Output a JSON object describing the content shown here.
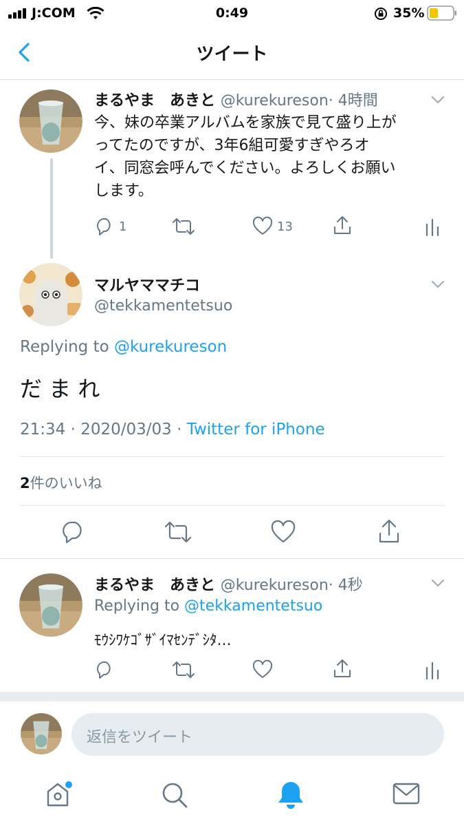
{
  "status_bar": {
    "carrier": "J:COM",
    "time": "0:49",
    "battery": "35%"
  },
  "nav": {
    "title": "ツイート"
  },
  "tweet1": {
    "name": "まるやま　あきと",
    "handle": "@kurekureson",
    "time": "· 4時間",
    "text_lines": [
      "今、妹の卒業アルバムを家族で見て盛り上が",
      "ってたのですが、3年6組可愛すぎやろオ",
      "イ、同窓会呼んでください。よろしくお願い",
      "します。"
    ],
    "reply_count": "1",
    "like_count": "13"
  },
  "main_tweet": {
    "name": "マルヤママチコ",
    "handle": "@tekkamentetsuo",
    "replying_prefix": "Replying to",
    "replying_handle": "@kurekureson",
    "text": "だ ま れ",
    "datetime": "21:34 · 2020/03/03 · ",
    "source": "Twitter for iPhone",
    "likes_count": "2",
    "likes_label": "件のいいね"
  },
  "tweet3": {
    "name": "まるやま　あきと",
    "handle": "@kurekureson",
    "time": "· 4秒",
    "replying_prefix": "Replying to",
    "replying_handle": "@tekkamentetsuo",
    "text": "ﾓｳｼﾜｹｺﾞｻﾞｲﾏｾﾝﾃﾞｼﾀ…"
  },
  "reply_box": {
    "placeholder": "返信をツイート"
  },
  "tab_bar": {
    "items": [
      "home-icon",
      "search-icon",
      "notifications-icon",
      "messages-icon"
    ],
    "active": "notifications-icon"
  },
  "colors": {
    "accent": "#1da1f2",
    "text": "#14171a",
    "secondary": "#657786"
  }
}
